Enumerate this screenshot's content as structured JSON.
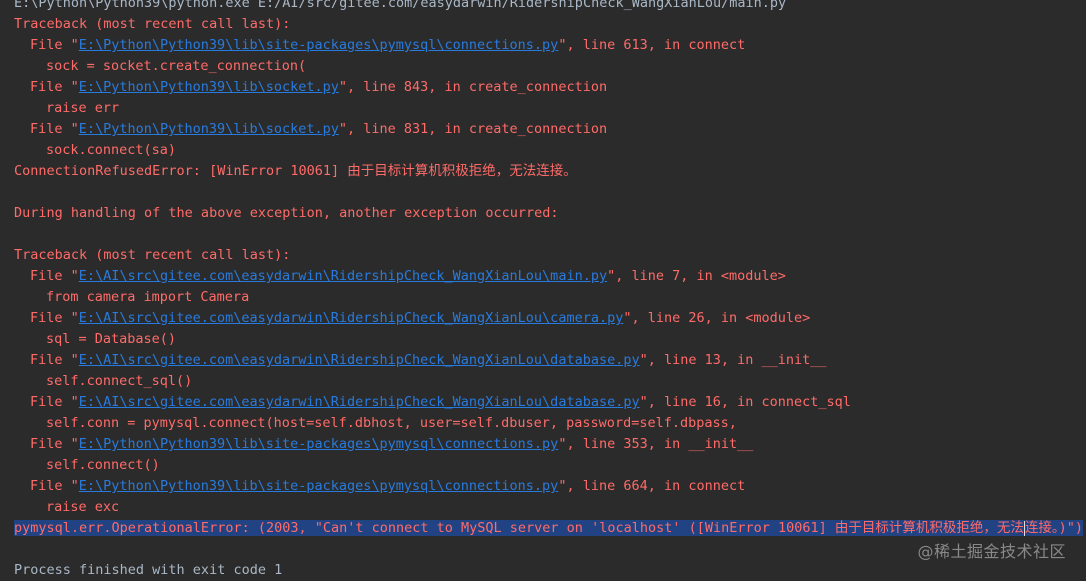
{
  "console": {
    "cmd": "E:\\Python\\Python39\\python.exe E:/AI/src/gitee.com/easydarwin/RidershipCheck_WangXianLou/main.py",
    "tb1_header": "Traceback (most recent call last):",
    "tb1_f1_pre": "File \"",
    "tb1_f1_link": "E:\\Python\\Python39\\lib\\site-packages\\pymysql\\connections.py",
    "tb1_f1_post": "\", line 613, in connect",
    "tb1_f1_code": "sock = socket.create_connection(",
    "tb1_f2_pre": "File \"",
    "tb1_f2_link": "E:\\Python\\Python39\\lib\\socket.py",
    "tb1_f2_post": "\", line 843, in create_connection",
    "tb1_f2_code": "raise err",
    "tb1_f3_pre": "File \"",
    "tb1_f3_link": "E:\\Python\\Python39\\lib\\socket.py",
    "tb1_f3_post": "\", line 831, in create_connection",
    "tb1_f3_code": "sock.connect(sa)",
    "tb1_error": "ConnectionRefusedError: [WinError 10061] 由于目标计算机积极拒绝，无法连接。",
    "during": "During handling of the above exception, another exception occurred:",
    "tb2_header": "Traceback (most recent call last):",
    "tb2_f1_pre": "File \"",
    "tb2_f1_link": "E:\\AI\\src\\gitee.com\\easydarwin\\RidershipCheck_WangXianLou\\main.py",
    "tb2_f1_post": "\", line 7, in <module>",
    "tb2_f1_code": "from camera import Camera",
    "tb2_f2_pre": "File \"",
    "tb2_f2_link": "E:\\AI\\src\\gitee.com\\easydarwin\\RidershipCheck_WangXianLou\\camera.py",
    "tb2_f2_post": "\", line 26, in <module>",
    "tb2_f2_code": "sql = Database()",
    "tb2_f3_pre": "File \"",
    "tb2_f3_link": "E:\\AI\\src\\gitee.com\\easydarwin\\RidershipCheck_WangXianLou\\database.py",
    "tb2_f3_post": "\", line 13, in __init__",
    "tb2_f3_code": "self.connect_sql()",
    "tb2_f4_pre": "File \"",
    "tb2_f4_link": "E:\\AI\\src\\gitee.com\\easydarwin\\RidershipCheck_WangXianLou\\database.py",
    "tb2_f4_post": "\", line 16, in connect_sql",
    "tb2_f4_code": "self.conn = pymysql.connect(host=self.dbhost, user=self.dbuser, password=self.dbpass,",
    "tb2_f5_pre": "File \"",
    "tb2_f5_link": "E:\\Python\\Python39\\lib\\site-packages\\pymysql\\connections.py",
    "tb2_f5_post": "\", line 353, in __init__",
    "tb2_f5_code": "self.connect()",
    "tb2_f6_pre": "File \"",
    "tb2_f6_link": "E:\\Python\\Python39\\lib\\site-packages\\pymysql\\connections.py",
    "tb2_f6_post": "\", line 664, in connect",
    "tb2_f6_code": "raise exc",
    "final_error_a": "pymysql.err.OperationalError: (2003, \"Can't connect to MySQL server on 'localhost' ([WinError 10061] 由于目标计算机积极拒绝，无法",
    "final_error_b": "连接。)\")",
    "finished": "Process finished with exit code 1"
  },
  "watermark": "@稀土掘金技术社区",
  "colors": {
    "background": "#2b2b2b",
    "error_text": "#ff6b68",
    "link": "#287bde",
    "normal_text": "#a9b7c6",
    "selection": "#214283"
  }
}
